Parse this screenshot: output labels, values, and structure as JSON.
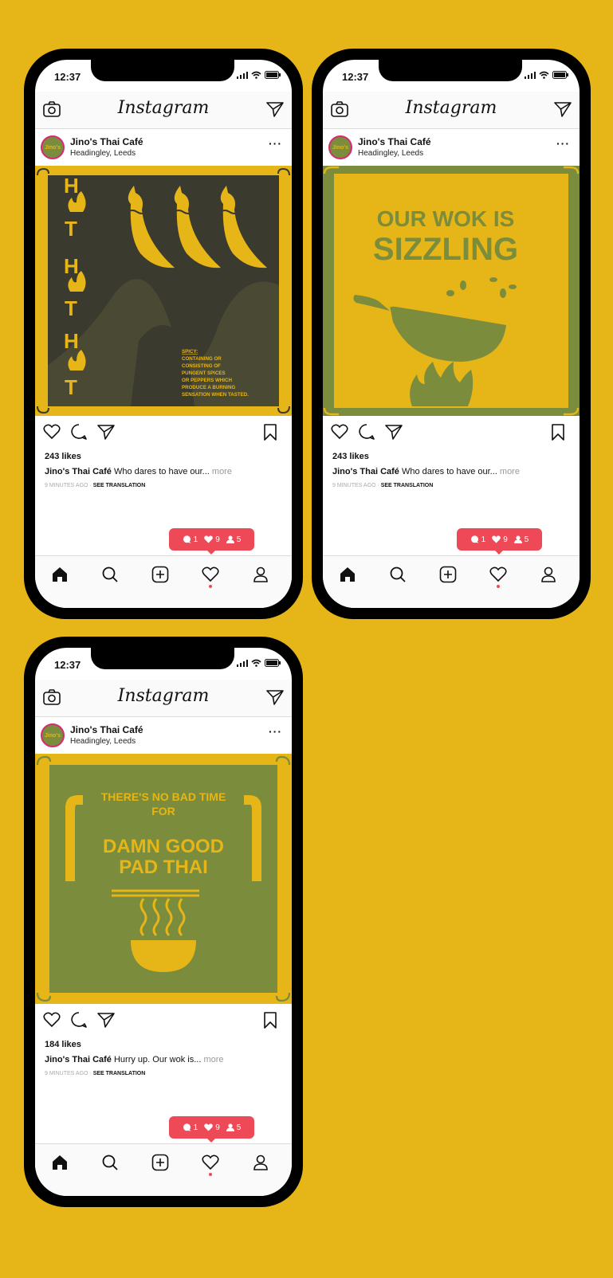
{
  "status": {
    "time": "12:37"
  },
  "app": {
    "logo": "Instagram"
  },
  "colors": {
    "background": "#e6b517",
    "olive": "#7b8c3c",
    "dark": "#3b3a2e",
    "notif": "#ed4956"
  },
  "posts": [
    {
      "account": "Jino's Thai Café",
      "location": "Headingley, Leeds",
      "avatar_text": "Jino's",
      "likes": "243 likes",
      "caption_user": "Jino's Thai Café",
      "caption_text": "Who dares to have our...",
      "more": "more",
      "time_ago": "9 MINUTES AGO",
      "see_translation": "SEE TRANSLATION",
      "notif": {
        "comments": "1",
        "likes": "9",
        "follows": "5"
      },
      "image": {
        "letters": [
          "H",
          "T",
          "H",
          "T",
          "H",
          "T"
        ],
        "definition_title": "SPICY:",
        "definition": [
          "CONTAINING OR",
          "CONSISTING OF",
          "PUNGENT SPICES",
          "OR PEPPERS WHICH",
          "PRODUCE A BURNING",
          "SENSATION WHEN TASTED."
        ]
      }
    },
    {
      "account": "Jino's Thai Café",
      "location": "Headingley, Leeds",
      "avatar_text": "Jino's",
      "likes": "243 likes",
      "caption_user": "Jino's Thai Café",
      "caption_text": "Who dares to have our...",
      "more": "more",
      "time_ago": "9 MINUTES AGO",
      "see_translation": "SEE TRANSLATION",
      "notif": {
        "comments": "1",
        "likes": "9",
        "follows": "5"
      },
      "image": {
        "line1": "OUR WOK IS",
        "line2": "SIZZLING"
      }
    },
    {
      "account": "Jino's Thai Café",
      "location": "Headingley, Leeds",
      "avatar_text": "Jino's",
      "likes": "184 likes",
      "caption_user": "Jino's Thai Café",
      "caption_text": "Hurry up. Our wok is...",
      "more": "more",
      "time_ago": "9 MINUTES AGO",
      "see_translation": "SEE TRANSLATION",
      "notif": {
        "comments": "1",
        "likes": "9",
        "follows": "5"
      },
      "image": {
        "line1": "THERE'S NO BAD TIME",
        "line2": "FOR",
        "line3": "DAMN GOOD",
        "line4": "PAD THAI"
      }
    }
  ]
}
